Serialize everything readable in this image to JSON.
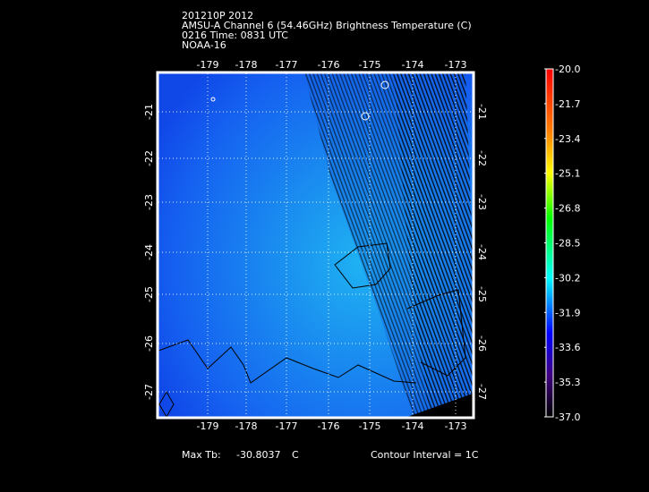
{
  "title": {
    "line1": "201210P 2012",
    "line2": "AMSU-A Channel 6 (54.46GHz) Brightness Temperature (C)",
    "line3": "0216 Time: 0831 UTC",
    "line4": "NOAA-16"
  },
  "map": {
    "lon_ticks": [
      "-179",
      "-178",
      "-177",
      "-176",
      "-175",
      "-174",
      "-173"
    ],
    "lat_ticks": [
      "-21",
      "-22",
      "-23",
      "-24",
      "-25",
      "-26",
      "-27"
    ]
  },
  "colorbar": {
    "labels": [
      "-20.0",
      "-21.7",
      "-23.4",
      "-25.1",
      "-26.8",
      "-28.5",
      "-30.2",
      "-31.9",
      "-33.6",
      "-35.3",
      "-37.0"
    ],
    "colors": [
      "#ff0000",
      "#ff8000",
      "#ffff00",
      "#00ff00",
      "#00ffff",
      "#0000ff",
      "#400080",
      "#000000"
    ]
  },
  "footer": {
    "max_tb_label": "Max Tb:",
    "max_tb_value": "-30.8037",
    "max_tb_unit": "C",
    "contour_interval": "Contour Interval = 1C"
  }
}
